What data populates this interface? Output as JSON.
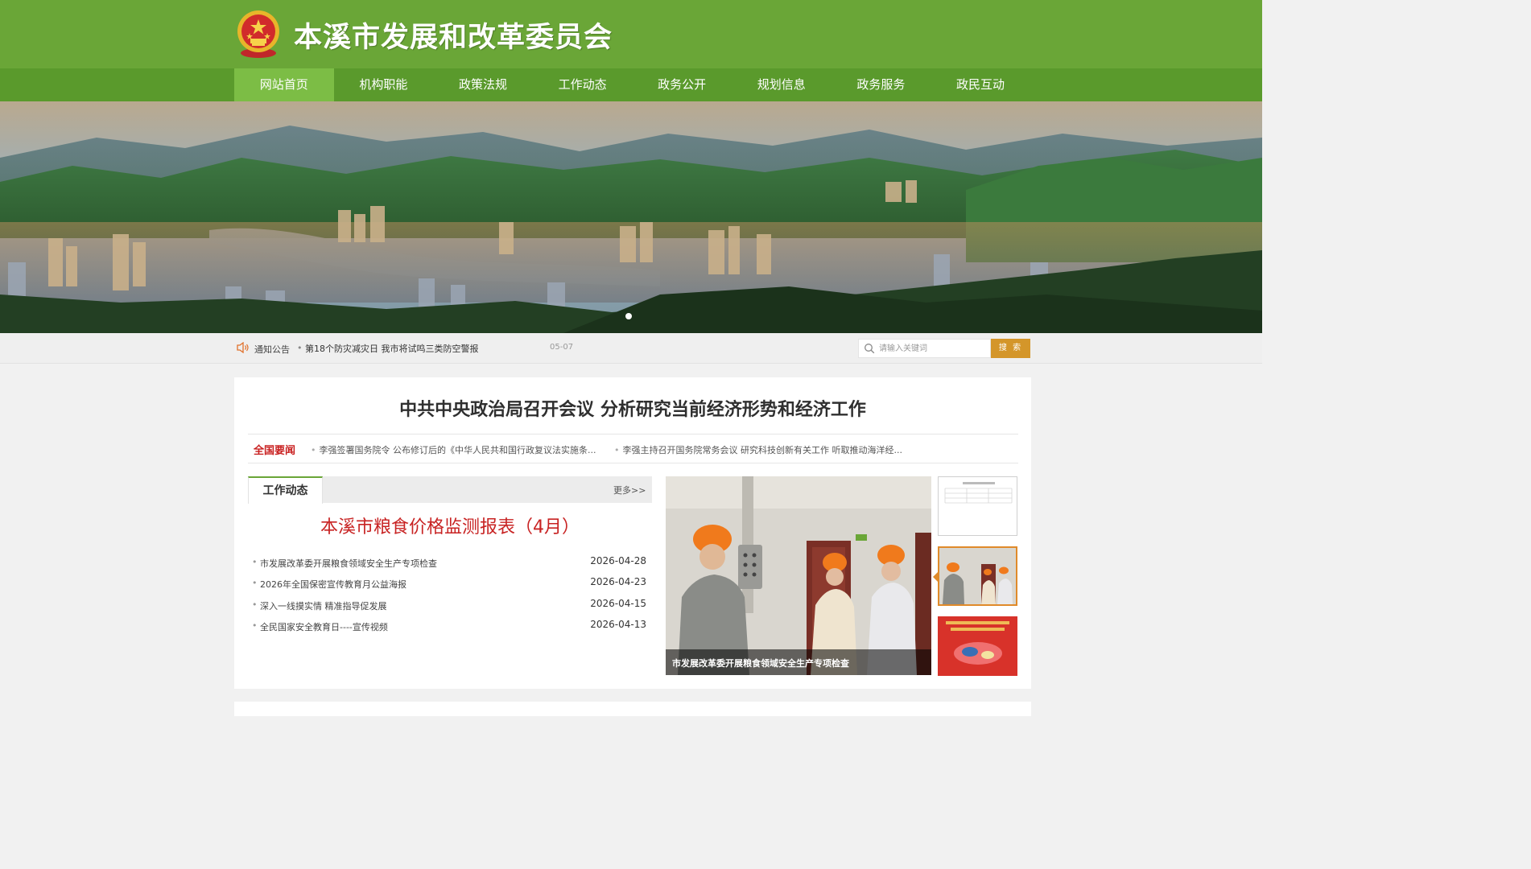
{
  "header": {
    "site_title": "本溪市发展和改革委员会"
  },
  "nav": {
    "items": [
      {
        "label": "网站首页",
        "active": true
      },
      {
        "label": "机构职能"
      },
      {
        "label": "政策法规"
      },
      {
        "label": "工作动态"
      },
      {
        "label": "政务公开"
      },
      {
        "label": "规划信息"
      },
      {
        "label": "政务服务"
      },
      {
        "label": "政民互动"
      }
    ]
  },
  "notice": {
    "label": "通知公告",
    "text": "第18个防灾减灾日 我市将试鸣三类防空警报",
    "date": "05-07"
  },
  "search": {
    "placeholder": "请输入关键词",
    "button": "搜 索"
  },
  "headline": "中共中央政治局召开会议 分析研究当前经济形势和经济工作",
  "national_news": {
    "label": "全国要闻",
    "items": [
      "李强签署国务院令 公布修订后的《中华人民共和国行政复议法实施条...",
      "李强主持召开国务院常务会议 研究科技创新有关工作 听取推动海洋经..."
    ]
  },
  "work_news": {
    "tab": "工作动态",
    "more": "更多>>",
    "feature_title": "本溪市粮食价格监测报表（4月）",
    "items": [
      {
        "title": "市发展改革委开展粮食领域安全生产专项检查",
        "date": "2026-04-28"
      },
      {
        "title": "2026年全国保密宣传教育月公益海报",
        "date": "2026-04-23"
      },
      {
        "title": "深入一线摸实情 精准指导促发展",
        "date": "2026-04-15"
      },
      {
        "title": "全民国家安全教育日----宣传视频",
        "date": "2026-04-13"
      }
    ]
  },
  "photo_slider": {
    "caption": "市发展改革委开展粮食领域安全生产专项检查",
    "active_thumb": 2
  },
  "colors": {
    "header_green": "#6aa637",
    "nav_green": "#5a9a2c",
    "nav_active": "#7cbd45",
    "headline_red": "#c82323",
    "search_button": "#d4962a"
  },
  "icons": [
    "national-emblem-icon",
    "speaker-icon",
    "search-icon"
  ]
}
